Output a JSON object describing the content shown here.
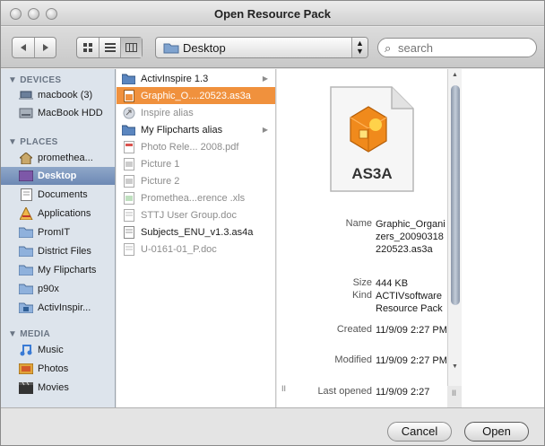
{
  "window": {
    "title": "Open Resource Pack"
  },
  "toolbar": {
    "back_icon": "chevron-left-icon",
    "forward_icon": "chevron-right-icon",
    "location": "Desktop",
    "search_placeholder": "search"
  },
  "sidebar": {
    "devices_header": "DEVICES",
    "devices": [
      "macbook (3)",
      "MacBook HDD"
    ],
    "places_header": "PLACES",
    "places": [
      "promethea...",
      "Desktop",
      "Documents",
      "Applications",
      "PromIT",
      "District Files",
      "My Flipcharts",
      "p90x",
      "ActivInspir..."
    ],
    "media_header": "MEDIA",
    "media": [
      "Music",
      "Photos",
      "Movies"
    ],
    "selected": "Desktop"
  },
  "files": [
    {
      "name": "ActivInspire 1.3",
      "type": "folder",
      "dim": false
    },
    {
      "name": "Graphic_O....20523.as3a",
      "type": "as3a",
      "dim": false,
      "selected": true
    },
    {
      "name": "Inspire alias",
      "type": "alias",
      "dim": true
    },
    {
      "name": "My Flipcharts alias",
      "type": "folder",
      "dim": false
    },
    {
      "name": "Photo Rele... 2008.pdf",
      "type": "pdf",
      "dim": true
    },
    {
      "name": "Picture 1",
      "type": "image",
      "dim": true
    },
    {
      "name": "Picture 2",
      "type": "image",
      "dim": true
    },
    {
      "name": "Promethea...erence .xls",
      "type": "xls",
      "dim": true
    },
    {
      "name": "STTJ User Group.doc",
      "type": "doc",
      "dim": true
    },
    {
      "name": "Subjects_ENU_v1.3.as4a",
      "type": "doc",
      "dim": false
    },
    {
      "name": "U-0161-01_P.doc",
      "type": "doc",
      "dim": true
    }
  ],
  "preview": {
    "badge": "AS3A",
    "name_label": "Name",
    "name_value": "Graphic_Organizers_20090318220523.as3a",
    "size_label": "Size",
    "size_value": "444 KB",
    "kind_label": "Kind",
    "kind_value": "ACTIVsoftware Resource Pack",
    "created_label": "Created",
    "created_value": "11/9/09 2:27 PM",
    "modified_label": "Modified",
    "modified_value": "11/9/09 2:27 PM",
    "opened_label": "Last opened",
    "opened_value": "11/9/09 2:27"
  },
  "buttons": {
    "cancel": "Cancel",
    "open": "Open"
  },
  "colors": {
    "selection_orange": "#f0913d",
    "sidebar_bg": "#dde4ec",
    "sidebar_selected": "#6d89b4"
  }
}
